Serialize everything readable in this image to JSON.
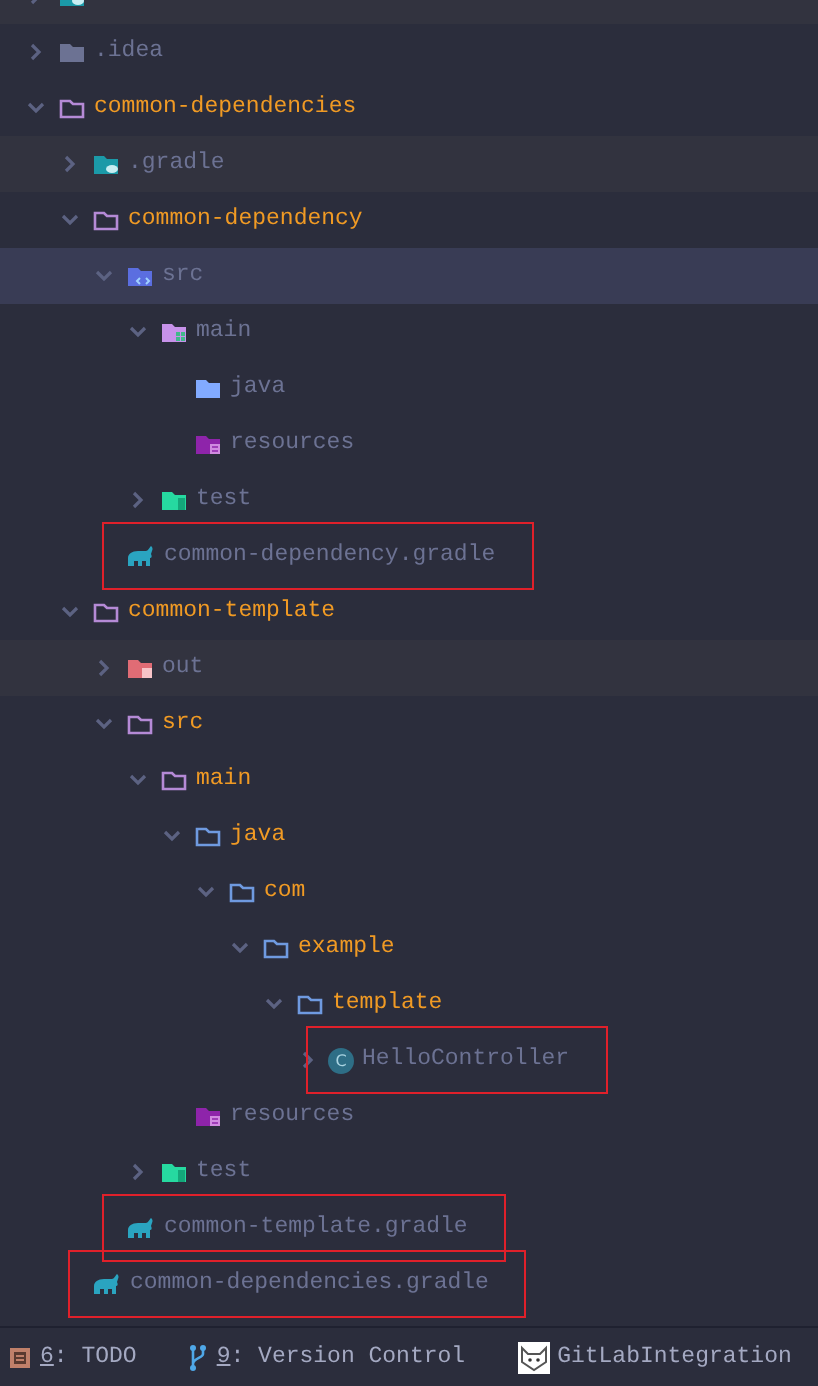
{
  "tree": [
    {
      "kind": "gradle-folder",
      "expanded": false,
      "excluded": true
    },
    {
      "label": ".idea",
      "kind": "idea-folder",
      "expanded": false,
      "modified": false
    },
    {
      "label": "common-dependencies",
      "kind": "folder",
      "expanded": true,
      "modified": true,
      "children": [
        {
          "label": ".gradle",
          "kind": "gradle-folder",
          "expanded": false,
          "modified": false,
          "excluded": true
        },
        {
          "label": "common-dependency",
          "kind": "folder",
          "expanded": true,
          "modified": true,
          "children": [
            {
              "label": "src",
              "kind": "source-folder",
              "expanded": true,
              "modified": false,
              "selected": true,
              "children": [
                {
                  "label": "main",
                  "kind": "module-folder",
                  "expanded": true,
                  "modified": false,
                  "children": [
                    {
                      "label": "java",
                      "kind": "java-folder",
                      "modified": false
                    },
                    {
                      "label": "resources",
                      "kind": "resources-folder",
                      "modified": false
                    }
                  ]
                },
                {
                  "label": "test",
                  "kind": "test-folder",
                  "expanded": false,
                  "modified": false
                }
              ]
            },
            {
              "label": "common-dependency.gradle",
              "kind": "gradle-file",
              "modified": false,
              "highlighted": true
            }
          ]
        },
        {
          "label": "common-template",
          "kind": "folder",
          "expanded": true,
          "modified": true,
          "children": [
            {
              "label": "out",
              "kind": "out-folder",
              "expanded": false,
              "modified": false,
              "excluded": true
            },
            {
              "label": "src",
              "kind": "folder",
              "expanded": true,
              "modified": true,
              "children": [
                {
                  "label": "main",
                  "kind": "main-folder",
                  "expanded": true,
                  "modified": true,
                  "children": [
                    {
                      "label": "java",
                      "kind": "package-folder",
                      "expanded": true,
                      "modified": true,
                      "children": [
                        {
                          "label": "com",
                          "kind": "package-folder",
                          "expanded": true,
                          "modified": true,
                          "children": [
                            {
                              "label": "example",
                              "kind": "package-folder",
                              "expanded": true,
                              "modified": true,
                              "children": [
                                {
                                  "label": "template",
                                  "kind": "package-folder",
                                  "expanded": true,
                                  "modified": true,
                                  "children": [
                                    {
                                      "label": "HelloController",
                                      "kind": "class",
                                      "icon_letter": "C",
                                      "expanded": false,
                                      "modified": false,
                                      "highlighted": true
                                    }
                                  ]
                                }
                              ]
                            }
                          ]
                        }
                      ]
                    },
                    {
                      "label": "resources",
                      "kind": "resources-folder",
                      "modified": false
                    }
                  ]
                },
                {
                  "label": "test",
                  "kind": "test-folder",
                  "expanded": false,
                  "modified": false
                }
              ]
            },
            {
              "label": "common-template.gradle",
              "kind": "gradle-file",
              "modified": false,
              "highlighted": true
            }
          ]
        },
        {
          "label": "common-dependencies.gradle",
          "kind": "gradle-file",
          "modified": false,
          "highlighted": true
        }
      ]
    }
  ],
  "status_bar": [
    {
      "mnemonic": "6",
      "label": ": TODO",
      "kind": "todo"
    },
    {
      "mnemonic": "9",
      "label": ": Version Control",
      "kind": "branch"
    },
    {
      "label": "GitLabIntegration",
      "kind": "gitlab"
    }
  ]
}
